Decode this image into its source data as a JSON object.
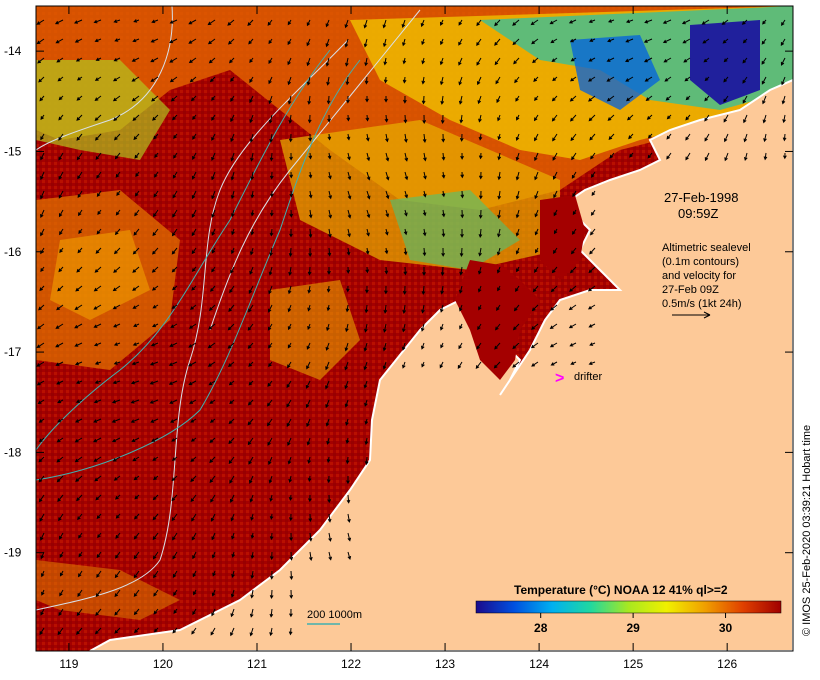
{
  "map": {
    "date_line1": "27-Feb-1998",
    "date_line2": "09:59Z",
    "altimetry_note": [
      "Altimetric sealevel",
      "(0.1m contours)",
      "and velocity for",
      "27-Feb 09Z",
      "0.5m/s (1kt 24h)"
    ],
    "drifter_symbol": ">",
    "drifter_label": "drifter",
    "depth_legend": "200  1000m",
    "credit": "© IMOS 25-Feb-2020 03:39:21 Hobart time",
    "lat_ticks": [
      "-14",
      "-15",
      "-16",
      "-17",
      "-18",
      "-19"
    ],
    "lon_ticks": [
      "119",
      "120",
      "121",
      "122",
      "123",
      "124",
      "125",
      "126"
    ],
    "lon_range": [
      118.65,
      126.7
    ],
    "lat_range": [
      -19.98,
      -13.55
    ],
    "colorbar": {
      "title": "Temperature (°C) NOAA 12 41% ql>=2",
      "ticks": [
        "28",
        "29",
        "30"
      ],
      "tick_values": [
        28,
        29,
        30
      ],
      "range": [
        27.3,
        30.6
      ],
      "colors": [
        "#1a0a8c",
        "#0050e0",
        "#00b0f0",
        "#20d8a0",
        "#a8e820",
        "#f0f000",
        "#f0a000",
        "#e04000",
        "#a00000"
      ]
    },
    "colors": {
      "land": "#fdc998",
      "ocean_warm": "#a40000",
      "coastline": "#ffffff",
      "contour": "#d8e0e8",
      "isobath": "#40b0b0",
      "drifter": "#ff00ff",
      "arrow": "#000000"
    }
  }
}
